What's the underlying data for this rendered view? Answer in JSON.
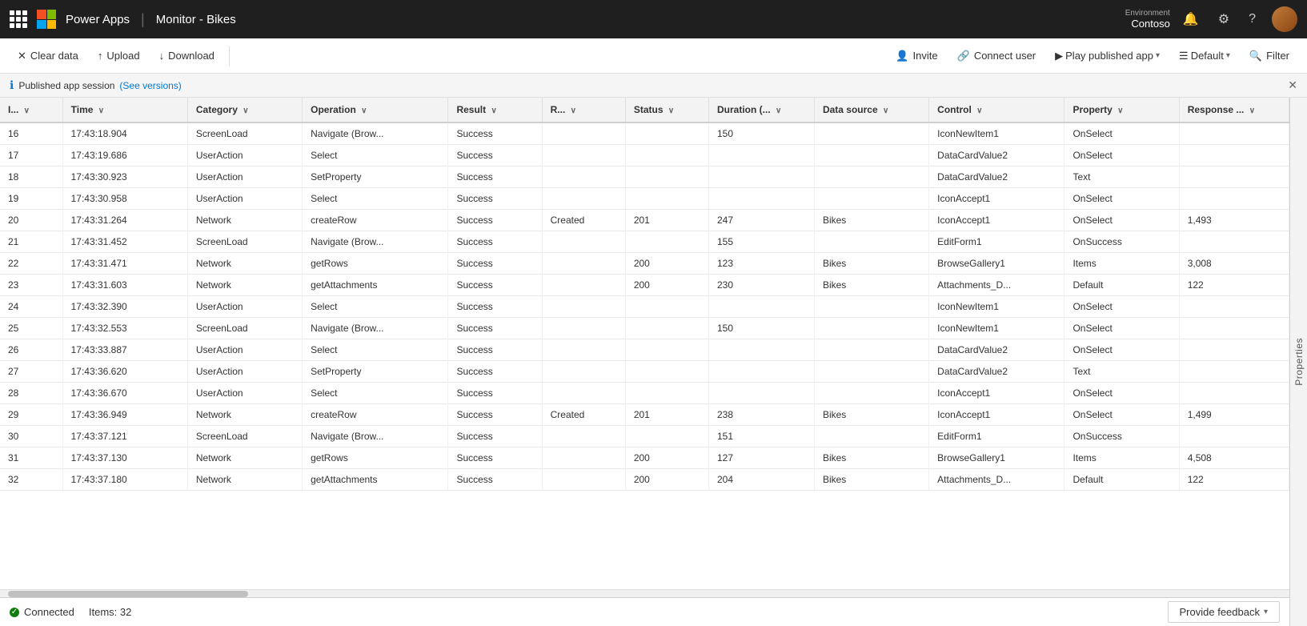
{
  "nav": {
    "waffle": "waffle-menu",
    "app_name": "Power Apps",
    "separator": "|",
    "monitor_title": "Monitor - Bikes",
    "env_label": "Environment",
    "env_name": "Contoso"
  },
  "toolbar": {
    "clear_data": "Clear data",
    "upload": "Upload",
    "download": "Download",
    "invite": "Invite",
    "connect_user": "Connect user",
    "play_published_app": "Play published app",
    "default": "Default",
    "filter": "Filter"
  },
  "info_bar": {
    "text": "Published app session",
    "link_text": "(See versions)"
  },
  "columns": [
    {
      "id": "I...",
      "label": "I..."
    },
    {
      "id": "time",
      "label": "Time"
    },
    {
      "id": "category",
      "label": "Category"
    },
    {
      "id": "operation",
      "label": "Operation"
    },
    {
      "id": "result",
      "label": "Result"
    },
    {
      "id": "r",
      "label": "R..."
    },
    {
      "id": "status",
      "label": "Status"
    },
    {
      "id": "duration",
      "label": "Duration (..."
    },
    {
      "id": "datasource",
      "label": "Data source"
    },
    {
      "id": "control",
      "label": "Control"
    },
    {
      "id": "property",
      "label": "Property"
    },
    {
      "id": "response",
      "label": "Response ..."
    }
  ],
  "rows": [
    {
      "id": 16,
      "time": "17:43:18.904",
      "category": "ScreenLoad",
      "operation": "Navigate (Brow...",
      "result": "Success",
      "r": "",
      "status": "",
      "duration": "150",
      "datasource": "",
      "control": "IconNewItem1",
      "property": "OnSelect",
      "response": ""
    },
    {
      "id": 17,
      "time": "17:43:19.686",
      "category": "UserAction",
      "operation": "Select",
      "result": "Success",
      "r": "",
      "status": "",
      "duration": "",
      "datasource": "",
      "control": "DataCardValue2",
      "property": "OnSelect",
      "response": ""
    },
    {
      "id": 18,
      "time": "17:43:30.923",
      "category": "UserAction",
      "operation": "SetProperty",
      "result": "Success",
      "r": "",
      "status": "",
      "duration": "",
      "datasource": "",
      "control": "DataCardValue2",
      "property": "Text",
      "response": ""
    },
    {
      "id": 19,
      "time": "17:43:30.958",
      "category": "UserAction",
      "operation": "Select",
      "result": "Success",
      "r": "",
      "status": "",
      "duration": "",
      "datasource": "",
      "control": "IconAccept1",
      "property": "OnSelect",
      "response": ""
    },
    {
      "id": 20,
      "time": "17:43:31.264",
      "category": "Network",
      "operation": "createRow",
      "result": "Success",
      "r": "Created",
      "status": "201",
      "duration": "247",
      "datasource": "Bikes",
      "control": "IconAccept1",
      "property": "OnSelect",
      "response": "1,493"
    },
    {
      "id": 21,
      "time": "17:43:31.452",
      "category": "ScreenLoad",
      "operation": "Navigate (Brow...",
      "result": "Success",
      "r": "",
      "status": "",
      "duration": "155",
      "datasource": "",
      "control": "EditForm1",
      "property": "OnSuccess",
      "response": ""
    },
    {
      "id": 22,
      "time": "17:43:31.471",
      "category": "Network",
      "operation": "getRows",
      "result": "Success",
      "r": "",
      "status": "200",
      "duration": "123",
      "datasource": "Bikes",
      "control": "BrowseGallery1",
      "property": "Items",
      "response": "3,008"
    },
    {
      "id": 23,
      "time": "17:43:31.603",
      "category": "Network",
      "operation": "getAttachments",
      "result": "Success",
      "r": "",
      "status": "200",
      "duration": "230",
      "datasource": "Bikes",
      "control": "Attachments_D...",
      "property": "Default",
      "response": "122"
    },
    {
      "id": 24,
      "time": "17:43:32.390",
      "category": "UserAction",
      "operation": "Select",
      "result": "Success",
      "r": "",
      "status": "",
      "duration": "",
      "datasource": "",
      "control": "IconNewItem1",
      "property": "OnSelect",
      "response": ""
    },
    {
      "id": 25,
      "time": "17:43:32.553",
      "category": "ScreenLoad",
      "operation": "Navigate (Brow...",
      "result": "Success",
      "r": "",
      "status": "",
      "duration": "150",
      "datasource": "",
      "control": "IconNewItem1",
      "property": "OnSelect",
      "response": ""
    },
    {
      "id": 26,
      "time": "17:43:33.887",
      "category": "UserAction",
      "operation": "Select",
      "result": "Success",
      "r": "",
      "status": "",
      "duration": "",
      "datasource": "",
      "control": "DataCardValue2",
      "property": "OnSelect",
      "response": ""
    },
    {
      "id": 27,
      "time": "17:43:36.620",
      "category": "UserAction",
      "operation": "SetProperty",
      "result": "Success",
      "r": "",
      "status": "",
      "duration": "",
      "datasource": "",
      "control": "DataCardValue2",
      "property": "Text",
      "response": ""
    },
    {
      "id": 28,
      "time": "17:43:36.670",
      "category": "UserAction",
      "operation": "Select",
      "result": "Success",
      "r": "",
      "status": "",
      "duration": "",
      "datasource": "",
      "control": "IconAccept1",
      "property": "OnSelect",
      "response": ""
    },
    {
      "id": 29,
      "time": "17:43:36.949",
      "category": "Network",
      "operation": "createRow",
      "result": "Success",
      "r": "Created",
      "status": "201",
      "duration": "238",
      "datasource": "Bikes",
      "control": "IconAccept1",
      "property": "OnSelect",
      "response": "1,499"
    },
    {
      "id": 30,
      "time": "17:43:37.121",
      "category": "ScreenLoad",
      "operation": "Navigate (Brow...",
      "result": "Success",
      "r": "",
      "status": "",
      "duration": "151",
      "datasource": "",
      "control": "EditForm1",
      "property": "OnSuccess",
      "response": ""
    },
    {
      "id": 31,
      "time": "17:43:37.130",
      "category": "Network",
      "operation": "getRows",
      "result": "Success",
      "r": "",
      "status": "200",
      "duration": "127",
      "datasource": "Bikes",
      "control": "BrowseGallery1",
      "property": "Items",
      "response": "4,508"
    },
    {
      "id": 32,
      "time": "17:43:37.180",
      "category": "Network",
      "operation": "getAttachments",
      "result": "Success",
      "r": "",
      "status": "200",
      "duration": "204",
      "datasource": "Bikes",
      "control": "Attachments_D...",
      "property": "Default",
      "response": "122"
    }
  ],
  "status": {
    "connected_label": "Connected",
    "items_label": "Items: 32"
  },
  "feedback": {
    "label": "Provide feedback"
  },
  "properties_panel": {
    "label": "Properties"
  }
}
